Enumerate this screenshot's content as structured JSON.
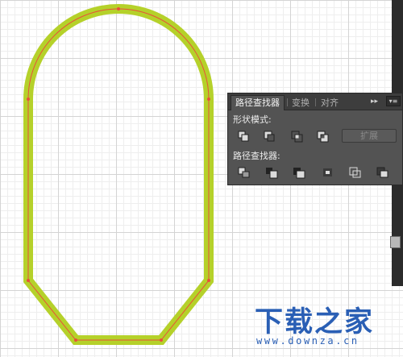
{
  "colors": {
    "stroke": "#b5d12a",
    "path": "#e8503a",
    "panel_bg": "#535353",
    "brand": "#2a5fb5"
  },
  "pathfinder": {
    "tabs": [
      {
        "label": "路径查找器",
        "active": true
      },
      {
        "label": "变换",
        "active": false
      },
      {
        "label": "对齐",
        "active": false
      }
    ],
    "collapse_icon": "collapse-icon",
    "menu_icon": "panel-menu-icon",
    "shape_modes": {
      "label": "形状模式:",
      "buttons": [
        "unite-icon",
        "minus-front-icon",
        "intersect-icon",
        "exclude-icon"
      ],
      "expand_label": "扩展"
    },
    "pathfinders": {
      "label": "路径查找器:",
      "buttons": [
        "divide-icon",
        "trim-icon",
        "merge-icon",
        "crop-icon",
        "outline-icon",
        "minus-back-icon"
      ]
    }
  },
  "watermark": {
    "title": "下载之家",
    "url": "www.downza.cn"
  }
}
